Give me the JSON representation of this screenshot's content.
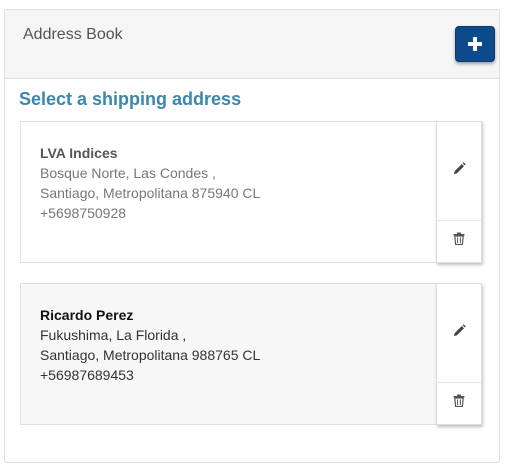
{
  "panel": {
    "title": "Address Book",
    "add_button_icon": "plus-icon"
  },
  "section": {
    "heading": "Select a shipping address"
  },
  "addresses": [
    {
      "name": "LVA Indices",
      "line1": "Bosque Norte, Las Condes ,",
      "line2": "Santiago, Metropolitana 875940 CL",
      "phone": "+5698750928",
      "selected": false,
      "edit_icon": "pencil-icon",
      "delete_icon": "trash-icon"
    },
    {
      "name": "Ricardo Perez",
      "line1": "Fukushima, La Florida ,",
      "line2": "Santiago, Metropolitana 988765 CL",
      "phone": "+56987689453",
      "selected": true,
      "edit_icon": "pencil-icon",
      "delete_icon": "trash-icon"
    }
  ],
  "colors": {
    "accent_button": "#0d4a8b",
    "heading": "#3a87ad",
    "header_bg": "#f5f5f5",
    "selected_card_bg": "#f7f7f7"
  }
}
